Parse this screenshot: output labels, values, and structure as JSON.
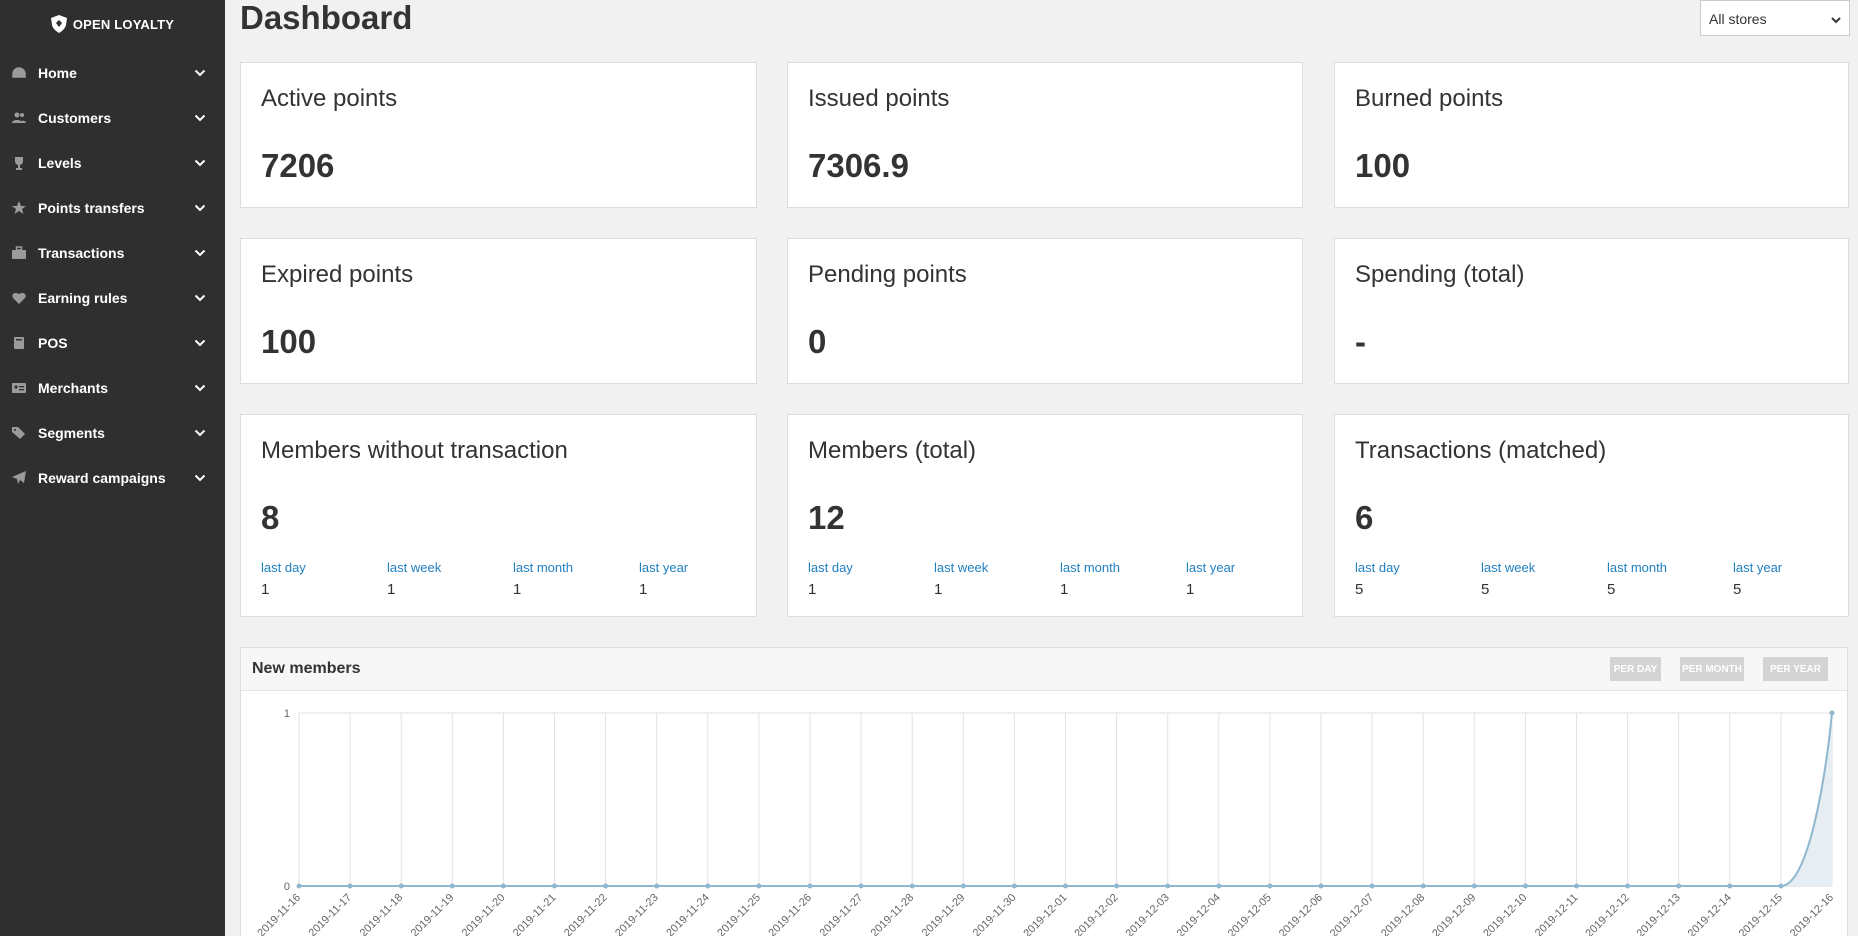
{
  "app": {
    "logo_text": "OPEN LOYALTY",
    "page_title": "Dashboard"
  },
  "header": {
    "store_select_value": "All stores"
  },
  "sidebar": {
    "items": [
      {
        "label": "Home",
        "icon": "dashboard-icon"
      },
      {
        "label": "Customers",
        "icon": "users-icon"
      },
      {
        "label": "Levels",
        "icon": "trophy-icon"
      },
      {
        "label": "Points transfers",
        "icon": "star-icon"
      },
      {
        "label": "Transactions",
        "icon": "briefcase-icon"
      },
      {
        "label": "Earning rules",
        "icon": "heart-icon"
      },
      {
        "label": "POS",
        "icon": "book-icon"
      },
      {
        "label": "Merchants",
        "icon": "id-card-icon"
      },
      {
        "label": "Segments",
        "icon": "tags-icon"
      },
      {
        "label": "Reward campaigns",
        "icon": "paper-plane-icon"
      }
    ]
  },
  "cards": [
    {
      "title": "Active points",
      "value": "7206"
    },
    {
      "title": "Issued points",
      "value": "7306.9"
    },
    {
      "title": "Burned points",
      "value": "100"
    },
    {
      "title": "Expired points",
      "value": "100"
    },
    {
      "title": "Pending points",
      "value": "0"
    },
    {
      "title": "Spending (total)",
      "value": "-"
    },
    {
      "title": "Members without transaction",
      "value": "8",
      "stats": [
        {
          "label": "last day",
          "value": "1"
        },
        {
          "label": "last week",
          "value": "1"
        },
        {
          "label": "last month",
          "value": "1"
        },
        {
          "label": "last year",
          "value": "1"
        }
      ]
    },
    {
      "title": "Members (total)",
      "value": "12",
      "stats": [
        {
          "label": "last day",
          "value": "1"
        },
        {
          "label": "last week",
          "value": "1"
        },
        {
          "label": "last month",
          "value": "1"
        },
        {
          "label": "last year",
          "value": "1"
        }
      ]
    },
    {
      "title": "Transactions (matched)",
      "value": "6",
      "stats": [
        {
          "label": "last day",
          "value": "5"
        },
        {
          "label": "last week",
          "value": "5"
        },
        {
          "label": "last month",
          "value": "5"
        },
        {
          "label": "last year",
          "value": "5"
        }
      ]
    }
  ],
  "chart_panel": {
    "title": "New members",
    "buttons": [
      "PER DAY",
      "PER MONTH",
      "PER YEAR"
    ]
  },
  "colors": {
    "sidebar_bg": "#2f2f2f",
    "link": "#1f7fc2",
    "series_line": "#8fb8cf",
    "series_fill": "#e6eef3"
  },
  "chart_data": {
    "type": "area",
    "title": "",
    "xlabel": "",
    "ylabel": "",
    "ylim": [
      0,
      1
    ],
    "yticks": [
      0,
      1
    ],
    "grid": true,
    "x": [
      "2019-11-16",
      "2019-11-17",
      "2019-11-18",
      "2019-11-19",
      "2019-11-20",
      "2019-11-21",
      "2019-11-22",
      "2019-11-23",
      "2019-11-24",
      "2019-11-25",
      "2019-11-26",
      "2019-11-27",
      "2019-11-28",
      "2019-11-29",
      "2019-11-30",
      "2019-12-01",
      "2019-12-02",
      "2019-12-03",
      "2019-12-04",
      "2019-12-05",
      "2019-12-06",
      "2019-12-07",
      "2019-12-08",
      "2019-12-09",
      "2019-12-10",
      "2019-12-11",
      "2019-12-12",
      "2019-12-13",
      "2019-12-14",
      "2019-12-15",
      "2019-12-16"
    ],
    "series": [
      {
        "values": [
          0,
          0,
          0,
          0,
          0,
          0,
          0,
          0,
          0,
          0,
          0,
          0,
          0,
          0,
          0,
          0,
          0,
          0,
          0,
          0,
          0,
          0,
          0,
          0,
          0,
          0,
          0,
          0,
          0,
          0,
          1
        ]
      }
    ]
  }
}
